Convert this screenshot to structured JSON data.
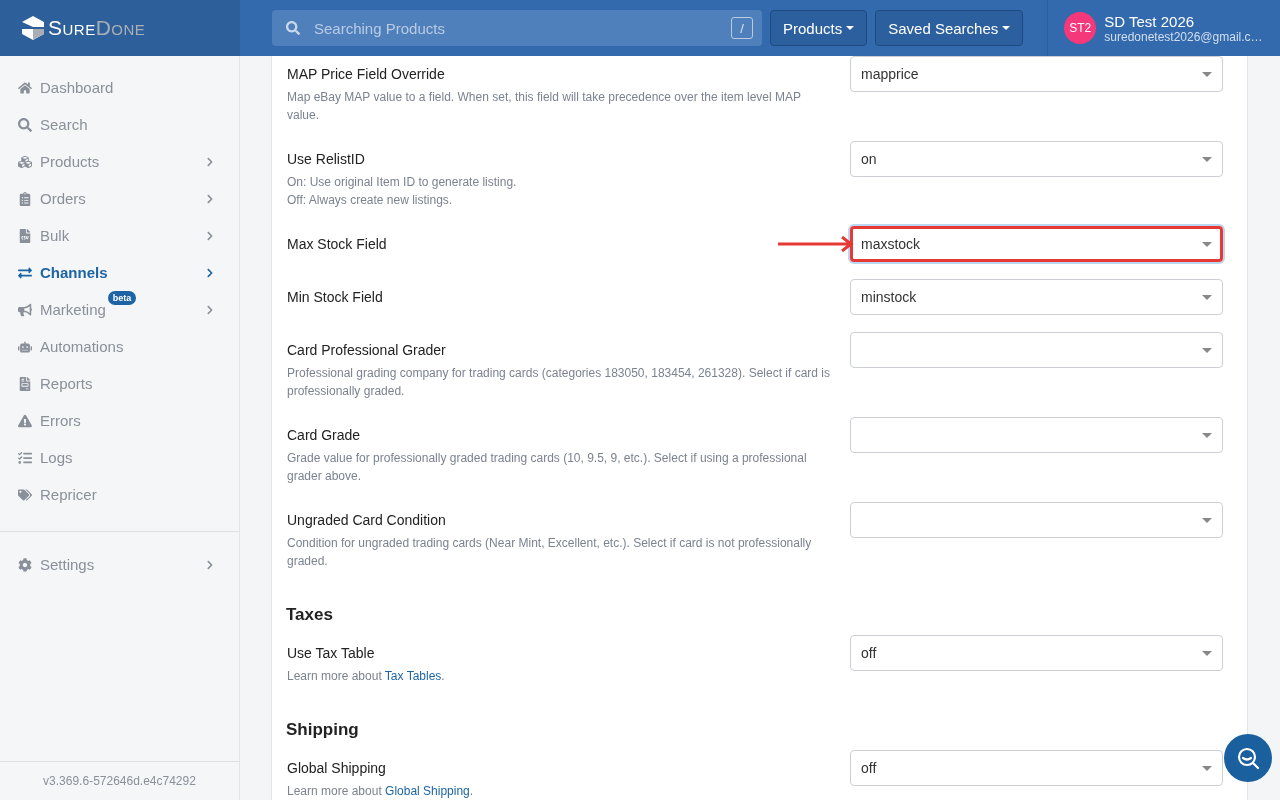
{
  "header": {
    "logo": {
      "first": "Sure",
      "second": "Done"
    },
    "search": {
      "placeholder": "Searching Products",
      "shortcut": "/"
    },
    "buttons": [
      "Products",
      "Saved Searches"
    ],
    "user": {
      "initials": "ST2",
      "name": "SD Test 2026",
      "email": "suredonetest2026@gmail.c…"
    }
  },
  "sidebar": {
    "items": [
      {
        "label": "Dashboard",
        "selected": false,
        "expandable": false
      },
      {
        "label": "Search",
        "selected": false,
        "expandable": false
      },
      {
        "label": "Products",
        "selected": false,
        "expandable": true
      },
      {
        "label": "Orders",
        "selected": false,
        "expandable": true
      },
      {
        "label": "Bulk",
        "selected": false,
        "expandable": true
      },
      {
        "label": "Channels",
        "selected": true,
        "expandable": true
      },
      {
        "label": "Marketing",
        "selected": false,
        "expandable": true,
        "badge": "beta"
      },
      {
        "label": "Automations",
        "selected": false,
        "expandable": false
      },
      {
        "label": "Reports",
        "selected": false,
        "expandable": false
      },
      {
        "label": "Errors",
        "selected": false,
        "expandable": false
      },
      {
        "label": "Logs",
        "selected": false,
        "expandable": false
      },
      {
        "label": "Repricer",
        "selected": false,
        "expandable": false
      }
    ],
    "bottom_items": [
      {
        "label": "Settings",
        "selected": false,
        "expandable": true
      }
    ],
    "version": "v3.369.6-572646d.e4c74292"
  },
  "sections": [
    {
      "fields": [
        {
          "label": "MAP Price Field Override",
          "description": [
            "Map eBay MAP value to a field. When set, this field will take precedence over the item level MAP value."
          ],
          "value": "mapprice",
          "highlighted": false
        },
        {
          "label": "Use RelistID",
          "description": [
            "On: Use original Item ID to generate listing.",
            "Off: Always create new listings."
          ],
          "value": "on",
          "highlighted": false
        },
        {
          "label": "Max Stock Field",
          "value": "maxstock",
          "highlighted": true
        },
        {
          "label": "Min Stock Field",
          "value": "minstock",
          "highlighted": false
        },
        {
          "label": "Card Professional Grader",
          "description": [
            "Professional grading company for trading cards (categories 183050, 183454, 261328). Select if card is professionally graded."
          ],
          "highlighted": false
        },
        {
          "label": "Card Grade",
          "description": [
            "Grade value for professionally graded trading cards (10, 9.5, 9, etc.). Select if using a professional grader above."
          ],
          "highlighted": false
        },
        {
          "label": "Ungraded Card Condition",
          "description": [
            "Condition for ungraded trading cards (Near Mint, Excellent, etc.). Select if card is not professionally graded."
          ],
          "highlighted": false
        }
      ]
    },
    {
      "title": "Taxes",
      "fields": [
        {
          "label": "Use Tax Table",
          "link_text": {
            "before": "Learn more about ",
            "link": "Tax Tables",
            "after": "."
          },
          "value": "off",
          "highlighted": false
        }
      ]
    },
    {
      "title": "Shipping",
      "fields": [
        {
          "label": "Global Shipping",
          "link_text": {
            "before": "Learn more about ",
            "link": "Global Shipping",
            "after": "."
          },
          "value": "off",
          "highlighted": false
        }
      ]
    }
  ]
}
